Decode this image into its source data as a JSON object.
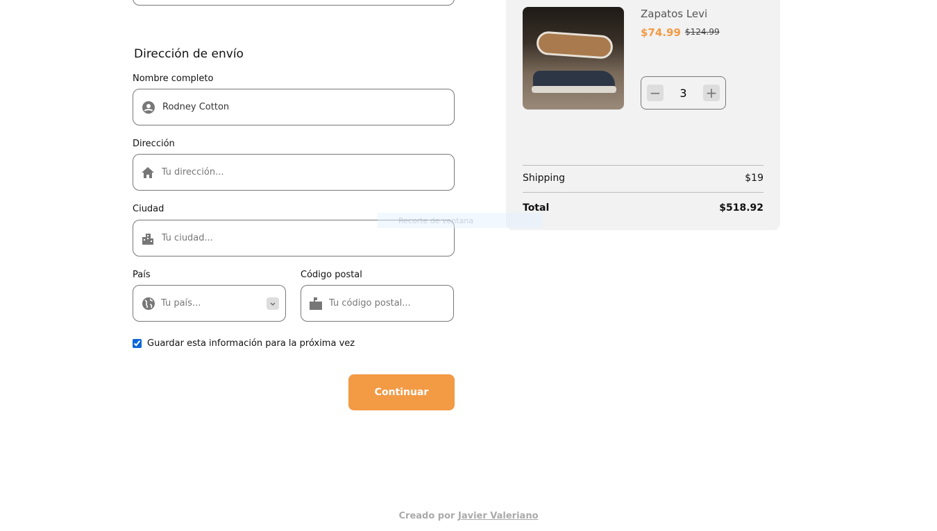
{
  "shipping_section": {
    "title": "Dirección de envío",
    "full_name": {
      "label": "Nombre completo",
      "value": "Rodney Cotton",
      "icon": "user-circle-icon"
    },
    "address": {
      "label": "Dirección",
      "placeholder": "Tu dirección...",
      "icon": "home-icon"
    },
    "city": {
      "label": "Ciudad",
      "placeholder": "Tu ciudad...",
      "icon": "city-icon"
    },
    "country": {
      "label": "País",
      "placeholder": "Tu país...",
      "icon": "globe-icon"
    },
    "postal": {
      "label": "Código postal",
      "placeholder": "Tu código postal...",
      "icon": "mailbox-icon"
    },
    "save_info": {
      "label": "Guardar esta información para la próxima vez",
      "checked": true
    },
    "continue_label": "Continuar"
  },
  "cart": {
    "item": {
      "name": "Zapatos Levi",
      "price": "$74.99",
      "original_price": "$124.99",
      "quantity": "3"
    },
    "shipping_label": "Shipping",
    "shipping_value": "$19",
    "total_label": "Total",
    "total_value": "$518.92"
  },
  "overlay": {
    "label": "Recorte de ventana"
  },
  "footer": {
    "prefix": "Creado por",
    "author": "Javier Valeriano"
  },
  "colors": {
    "accent": "#f39a45",
    "panel": "#f2f2f2"
  }
}
